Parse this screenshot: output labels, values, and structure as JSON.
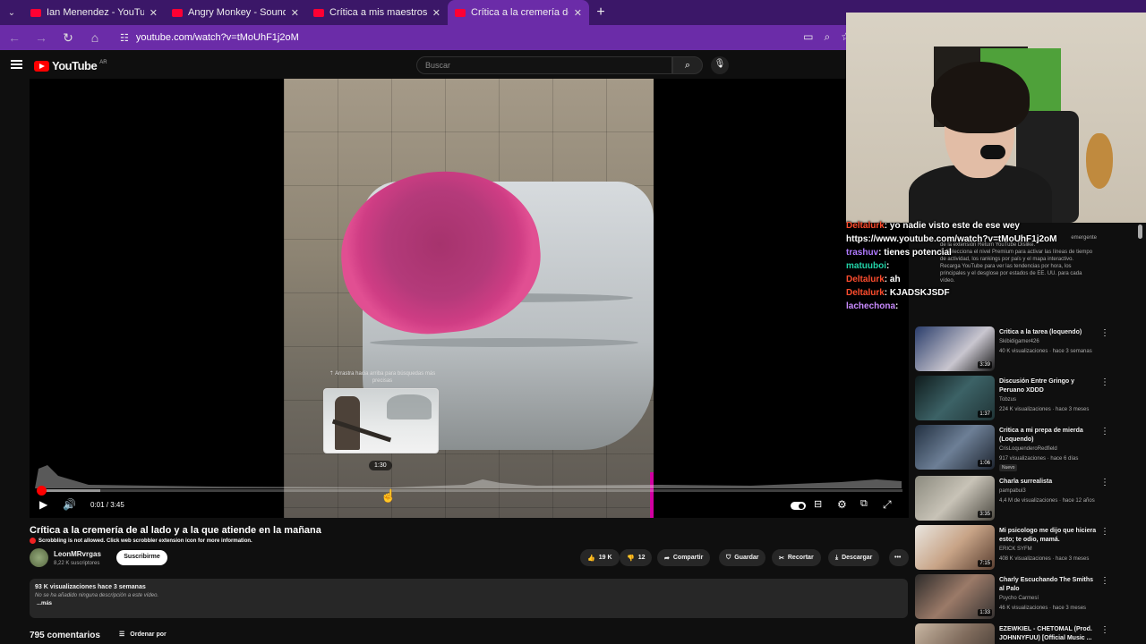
{
  "browser": {
    "tabs": [
      {
        "title": "Ian Menendez - YouTube",
        "active": false
      },
      {
        "title": "Angry Monkey - Sound Effect -",
        "active": false
      },
      {
        "title": "Crítica a mis maestros de la uni",
        "active": false
      },
      {
        "title": "Crítica a la cremería de al lado y",
        "active": true
      }
    ],
    "url": "youtube.com/watch?v=tMoUhF1j2oM"
  },
  "youtube": {
    "logo_text": "YouTube",
    "region": "AR",
    "search_placeholder": "Buscar"
  },
  "player": {
    "drag_hint": "Arrastra hacia arriba para búsquedas más precisas",
    "preview_time": "1:30",
    "time_display": "0:01 / 3:45",
    "played_fraction": 0.004,
    "buffered_fraction": 0.07,
    "accent_color": "#ff0000"
  },
  "video": {
    "title": "Crítica a la cremería de al lado y a la que atiende en la mañana",
    "scrobble_notice": "Scrobbling is not allowed. Click web scrobbler extension icon for more information.",
    "channel": "LeonMRvrgas",
    "subscribers": "8,22 K suscriptores",
    "subscribe_label": "Suscribirme",
    "likes": "19 K",
    "dislikes": "12",
    "share_label": "Compartir",
    "save_label": "Guardar",
    "clip_label": "Recortar",
    "download_label": "Descargar",
    "views_meta": "93 K visualizaciones  hace 3 semanas",
    "no_description": "No se ha añadido ninguna descripción a este vídeo.",
    "more_label": "...más",
    "comments_count": "795 comentarios",
    "sort_label": "Ordenar por"
  },
  "chat": [
    {
      "user": "Deltalurk",
      "text": ": yo nadie visto este de ese wey",
      "color": "#ff4d2e"
    },
    {
      "user": "",
      "text": "https://www.youtube.com/watch?v=tMoUhF1j2oM",
      "color": "#ffffff"
    },
    {
      "user": "trashuv",
      "text": ": tienes potencial",
      "color": "#b07aff"
    },
    {
      "user": "matuuboi",
      "text": ":",
      "color": "#22d3a8"
    },
    {
      "user": "Deltalurk",
      "text": ": ah",
      "color": "#ff4d2e"
    },
    {
      "user": "Deltalurk",
      "text": ": KJADSKJSDF",
      "color": "#ff4d2e"
    },
    {
      "user": "lachechona",
      "text": ":",
      "color": "#c98bff"
    }
  ],
  "trending_note": [
    "emergente",
    "de la extensión Return YouTube Dislike.",
    "2. Selecciona el nivel Premium para activar las líneas de tiempo de actividad, los rankings por país y el mapa interactivo.",
    "Recarga YouTube para ver las tendencias por hora, los principales y el desglose por estados de EE. UU. para cada vídeo."
  ],
  "suggestions": [
    {
      "title": "Critica a la tarea (loquendo)",
      "channel": "Skibidigamer426",
      "meta": "40 K visualizaciones · hace 3 semanas",
      "duration": "3:39",
      "badge": ""
    },
    {
      "title": "Discusión Entre Gringo y Peruano XDDD",
      "channel": "Tobzus",
      "meta": "224 K visualizaciones · hace 3 meses",
      "duration": "1:37",
      "badge": ""
    },
    {
      "title": "Critica a mi prepa de mierda (Loquendo)",
      "channel": "CrisLoquenderoRedfield",
      "meta": "917 visualizaciones · hace 6 días",
      "duration": "1:06",
      "badge": "Nuevo"
    },
    {
      "title": "Charla surrealista",
      "channel": "pampabui3",
      "meta": "4,4 M de visualizaciones · hace 12 años",
      "duration": "3:35",
      "badge": ""
    },
    {
      "title": "Mi psicologo me dijo que hiciera esto; te odio, mamá.",
      "channel": "ERICK SYFM",
      "meta": "408 K visualizaciones · hace 3 meses",
      "duration": "7:15",
      "badge": ""
    },
    {
      "title": "Charly Escuchando The Smiths al Palo",
      "channel": "Psycho Carmesí",
      "meta": "46 K visualizaciones · hace 3 meses",
      "duration": "1:33",
      "badge": ""
    },
    {
      "title": "EZEWKIEL - CHETOMAL (Prod. JOHNNYFUU) [Official Music ...",
      "channel": "",
      "meta": "",
      "duration": "",
      "badge": ""
    }
  ]
}
